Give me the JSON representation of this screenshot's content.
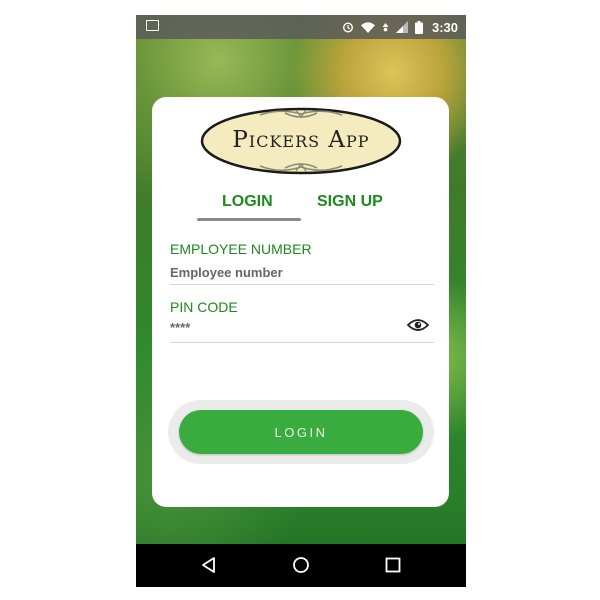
{
  "status_bar": {
    "time": "3:30",
    "icons": [
      "image-icon",
      "alarm-icon",
      "wifi-icon",
      "data-icon",
      "signal-icon",
      "battery-icon"
    ]
  },
  "logo": {
    "text": "Pickers App"
  },
  "tabs": {
    "login": "LOGIN",
    "signup": "SIGN UP",
    "active": "login"
  },
  "employee_number": {
    "label": "EMPLOYEE NUMBER",
    "placeholder": "Employee number",
    "value": ""
  },
  "pin_code": {
    "label": "PIN CODE",
    "placeholder": "****",
    "value": "",
    "toggle_icon": "eye-icon"
  },
  "login_button": {
    "label": "LOGIN"
  },
  "nav_bar": {
    "icons": [
      "back-icon",
      "home-icon",
      "recents-icon"
    ]
  },
  "colors": {
    "accent_green": "#1e8a1e",
    "button_green": "#3aab3f",
    "status_bar": "#5a5a5a",
    "nav_bar": "#000000"
  }
}
